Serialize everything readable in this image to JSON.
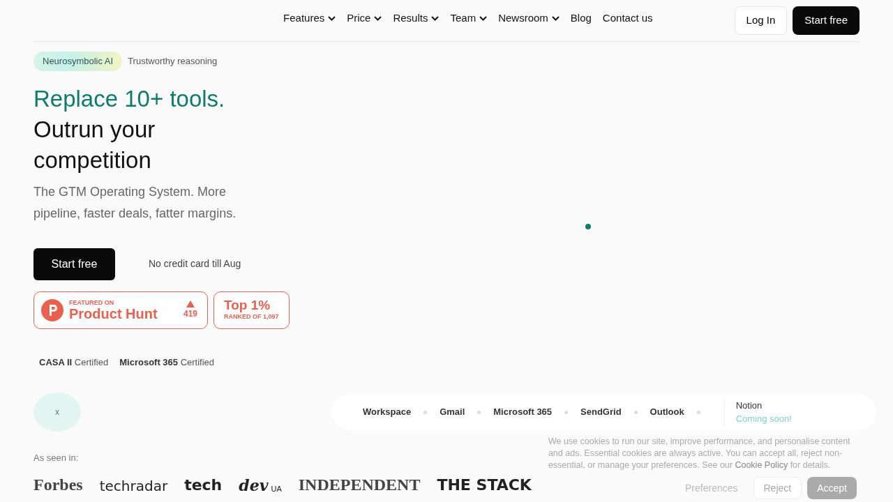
{
  "nav": {
    "items": [
      {
        "label": "Features",
        "dropdown": true
      },
      {
        "label": "Price",
        "dropdown": true
      },
      {
        "label": "Results",
        "dropdown": true
      },
      {
        "label": "Team",
        "dropdown": true
      },
      {
        "label": "Newsroom",
        "dropdown": true
      },
      {
        "label": "Blog",
        "dropdown": false
      },
      {
        "label": "Contact us",
        "dropdown": false
      }
    ],
    "login": "Log In",
    "start": "Start free"
  },
  "tagline": {
    "badge": "Neurosymbolic AI",
    "text": "Trustworthy reasoning"
  },
  "hero": {
    "headline_accent": "Replace 10+ tools.",
    "headline": "Outrun your competition",
    "subtitle": "The GTM Operating System. More pipeline, faster deals, fatter margins.",
    "cta": "Start free",
    "note": "No credit card till Aug"
  },
  "badges": {
    "product_hunt": {
      "featured": "FEATURED ON",
      "name": "Product Hunt",
      "votes": "419"
    },
    "rank": {
      "title": "Top 1%",
      "sub": "RANKED OF 1,097"
    }
  },
  "certifications": [
    {
      "name": "CASA II",
      "suffix": "Certified"
    },
    {
      "name": "Microsoft 365",
      "suffix": "Certified"
    }
  ],
  "close_label": "x",
  "integrations": [
    {
      "name": "Workspace"
    },
    {
      "name": "Gmail"
    },
    {
      "name": "Microsoft 365"
    },
    {
      "name": "SendGrid"
    },
    {
      "name": "Outlook"
    }
  ],
  "upcoming": {
    "name": "Notion",
    "note": "Coming soon!"
  },
  "press": {
    "label": "As seen in:",
    "logos": [
      {
        "text": "Forbes",
        "kind": "serif"
      },
      {
        "text": "techradar",
        "kind": "sans"
      },
      {
        "text": "tech",
        "kind": "heavy"
      },
      {
        "text": "dev",
        "kind": "script",
        "suffix": "UA"
      },
      {
        "text": "INDEPENDENT",
        "kind": "serif"
      },
      {
        "text": "THE STACK",
        "kind": "heavy"
      }
    ]
  },
  "cookie": {
    "text": "We use cookies to run our site, improve performance, and personalise content and ads. Essential cookies are always active. You can accept all, reject non-essential, or manage your preferences. See our **Cookie Policy** for details.",
    "buttons": [
      {
        "label": "Preferences",
        "kind": "link"
      },
      {
        "label": "Reject",
        "kind": "outline"
      },
      {
        "label": "Accept",
        "kind": "solid"
      }
    ]
  }
}
